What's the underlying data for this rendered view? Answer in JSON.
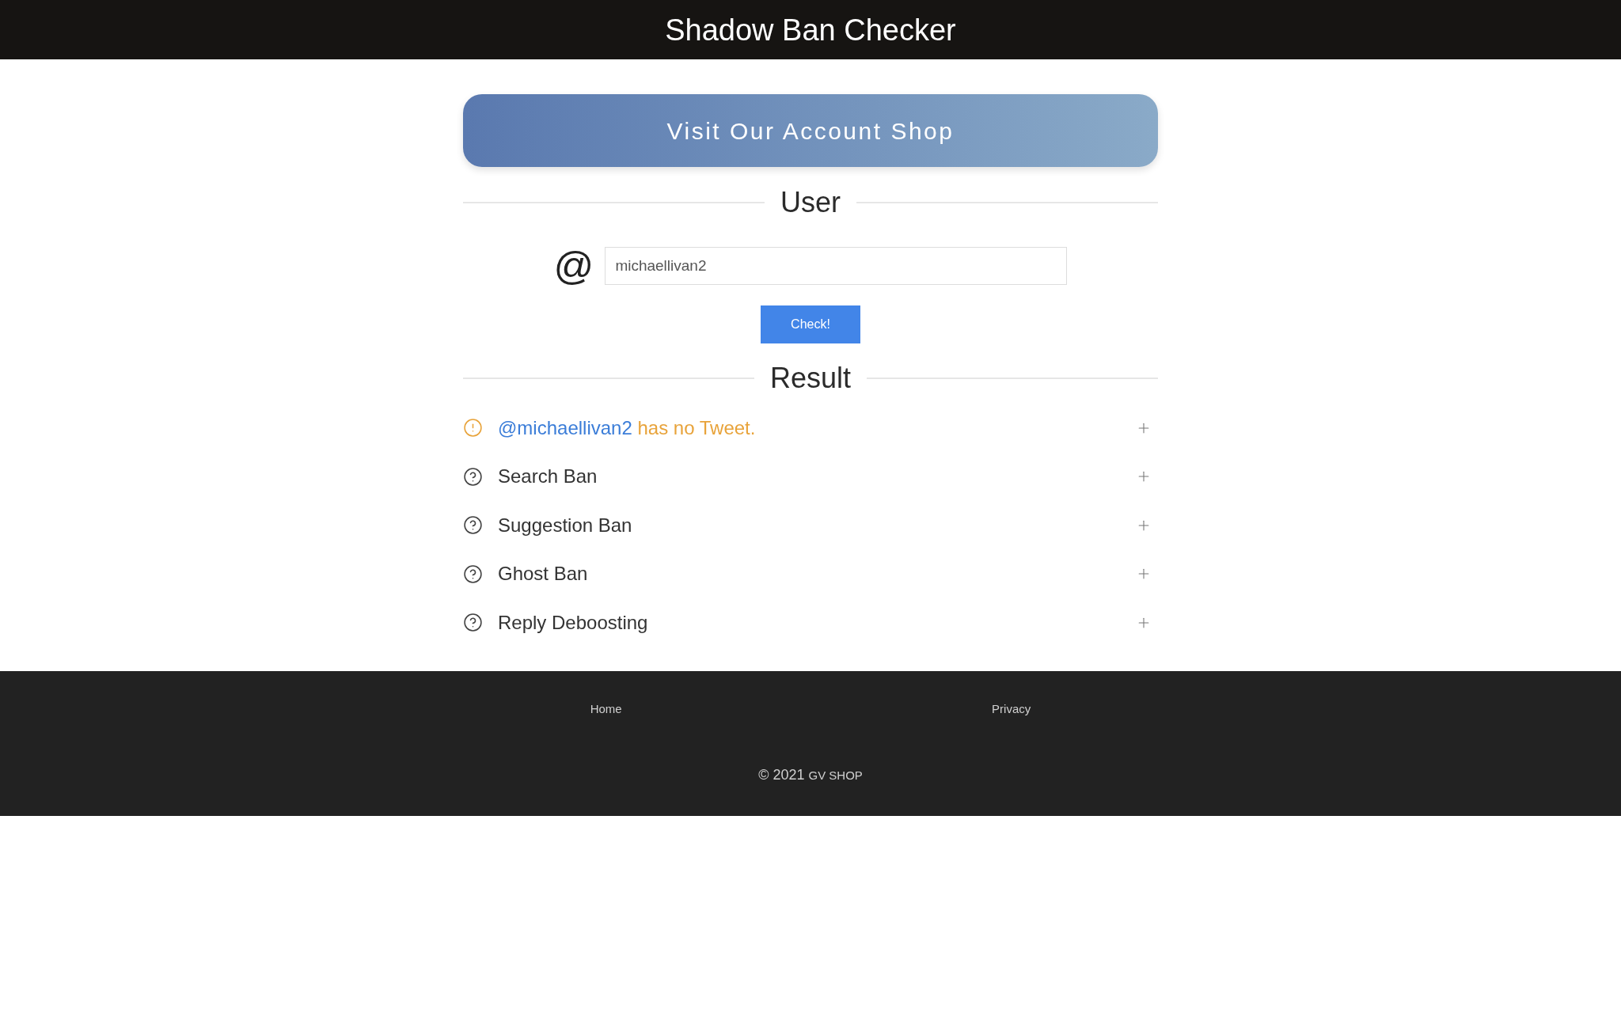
{
  "header": {
    "title": "Shadow Ban Checker"
  },
  "banner": {
    "label": "Visit Our Account Shop"
  },
  "user_section": {
    "heading": "User",
    "prefix": "@",
    "input": {
      "value": "michaellivan2"
    },
    "button": "Check!"
  },
  "result_section": {
    "heading": "Result",
    "items": [
      {
        "kind": "warning",
        "handle": "@michaellivan2",
        "message": "has no Tweet.",
        "expanded": false
      },
      {
        "kind": "unknown",
        "label": "Search Ban",
        "expanded": false
      },
      {
        "kind": "unknown",
        "label": "Suggestion Ban",
        "expanded": false
      },
      {
        "kind": "unknown",
        "label": "Ghost Ban",
        "expanded": false
      },
      {
        "kind": "unknown",
        "label": "Reply Deboosting",
        "expanded": false
      }
    ]
  },
  "footer": {
    "links": [
      "Home",
      "Privacy"
    ],
    "copyright": "© 2021",
    "brand": "GV SHOP"
  }
}
